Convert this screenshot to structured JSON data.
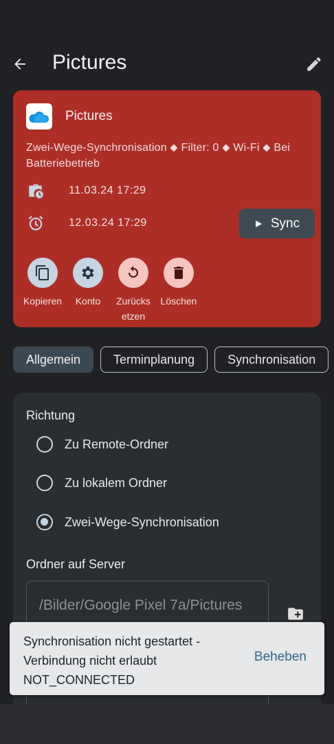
{
  "appbar": {
    "title": "Pictures",
    "back_icon": "arrow-left-icon",
    "edit_icon": "pencil-icon"
  },
  "card": {
    "bg_color": "#ad2e27",
    "app_icon": "onedrive-cloud-icon",
    "title": "Pictures",
    "description": "Zwei-Wege-Synchronisation ⬥ Filter: 0 ⬥ Wi-Fi ⬥ Bei Batteriebetrieb",
    "last_sync_date": "11.03.24 17:29",
    "next_sync_date": "12.03.24 17:29",
    "sync_label": "Sync",
    "actions": [
      {
        "label": "Kopieren",
        "icon": "copy-icon"
      },
      {
        "label": "Konto",
        "icon": "gear-icon"
      },
      {
        "label": "Zurücks etzen",
        "icon": "reset-icon"
      },
      {
        "label": "Löschen",
        "icon": "trash-icon"
      }
    ]
  },
  "tabs": [
    {
      "label": "Allgemein",
      "active": true
    },
    {
      "label": "Terminplanung",
      "active": false
    },
    {
      "label": "Synchronisation",
      "active": false
    }
  ],
  "panel": {
    "direction_title": "Richtung",
    "options": [
      {
        "label": "Zu Remote-Ordner",
        "checked": false
      },
      {
        "label": "Zu lokalem Ordner",
        "checked": false
      },
      {
        "label": "Zwei-Wege-Synchronisation",
        "checked": true
      }
    ],
    "server_folder_title": "Ordner auf Server",
    "server_folder_value": "/Bilder/Google Pixel 7a/Pictures"
  },
  "snackbar": {
    "message": "Synchronisation nicht gestartet - Verbindung nicht erlaubt NOT_CONNECTED",
    "action_label": "Beheben"
  }
}
